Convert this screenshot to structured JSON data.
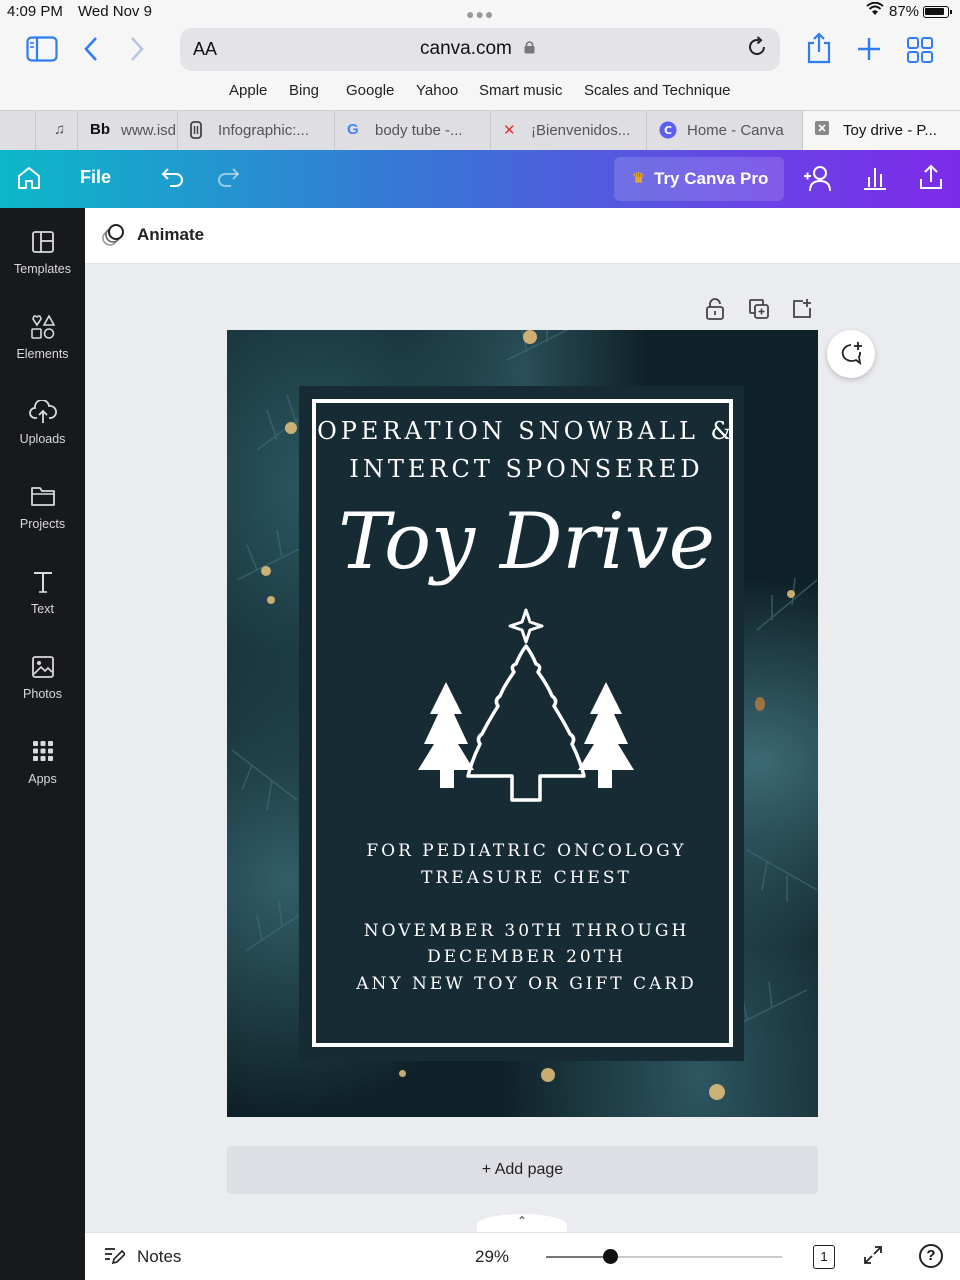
{
  "status_bar": {
    "time": "4:09 PM",
    "date": "Wed Nov 9",
    "battery": "87%"
  },
  "browser": {
    "aa_label": "AA",
    "url": "canva.com",
    "bookmarks": [
      "Apple",
      "Bing",
      "Google",
      "Yahoo",
      "Smart music",
      "Scales and Technique"
    ],
    "tabs": [
      {
        "icon": "music-note-icon",
        "title": ""
      },
      {
        "icon": "blackboard-icon",
        "badge": "Bb",
        "title": "www.isd"
      },
      {
        "icon": "infographic-icon",
        "title": "Infographic:..."
      },
      {
        "icon": "google-icon",
        "badge": "G",
        "title": "body tube -..."
      },
      {
        "icon": "site-icon",
        "title": "¡Bienvenidos..."
      },
      {
        "icon": "canva-icon",
        "badge": "C",
        "title": "Home - Canva"
      },
      {
        "icon": "close-tab-icon",
        "title": "Toy drive - P..."
      }
    ]
  },
  "canva_header": {
    "file_label": "File",
    "try_pro_label": "Try Canva Pro"
  },
  "sidebar": {
    "items": [
      {
        "label": "Templates",
        "icon": "templates-icon"
      },
      {
        "label": "Elements",
        "icon": "elements-icon"
      },
      {
        "label": "Uploads",
        "icon": "uploads-icon"
      },
      {
        "label": "Projects",
        "icon": "projects-icon"
      },
      {
        "label": "Text",
        "icon": "text-icon"
      },
      {
        "label": "Photos",
        "icon": "photos-icon"
      },
      {
        "label": "Apps",
        "icon": "apps-icon"
      }
    ]
  },
  "toolbar": {
    "animate_label": "Animate"
  },
  "design": {
    "line1": "OPERATION SNOWBALL &",
    "line2": "INTERCT SPONSERED",
    "script_title": "Toy Drive",
    "for_line1": "FOR PEDIATRIC ONCOLOGY",
    "for_line2": "TREASURE CHEST",
    "date_line1": "NOVEMBER 30TH THROUGH",
    "date_line2": "DECEMBER 20TH",
    "date_line3": "ANY NEW TOY OR GIFT CARD"
  },
  "editor": {
    "add_page_label": "+ Add page"
  },
  "bottom_bar": {
    "notes_label": "Notes",
    "zoom": "29%",
    "zoom_level": 0.27,
    "page_count": "1"
  },
  "colors": {
    "header_start": "#0cb8c9",
    "header_end": "#7d2ae8",
    "sidebar_bg": "#18191b",
    "panel": "#172b35"
  }
}
